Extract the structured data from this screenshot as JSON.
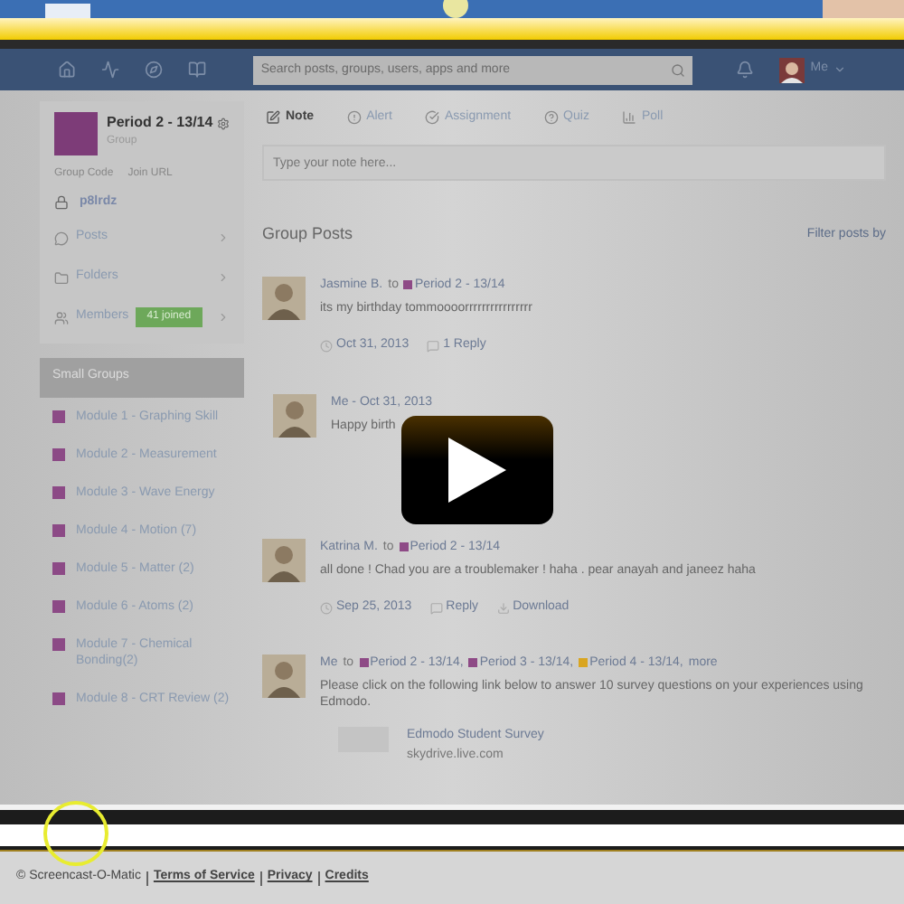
{
  "nav": {
    "search": {
      "placeholder": "Search posts, groups, users, apps and more"
    },
    "user": "Me"
  },
  "group": {
    "title": "Period 2 - 13/14",
    "subtitle": "Group",
    "links": [
      "Group Code",
      "Join URL"
    ],
    "code": "p8lrdz"
  },
  "sidebar": {
    "items": [
      {
        "kind": "posts",
        "label": "Posts"
      },
      {
        "kind": "folders",
        "label": "Folders"
      },
      {
        "kind": "members",
        "label": "Members",
        "badge": "41 joined"
      }
    ]
  },
  "small_groups": {
    "title": "Small Groups",
    "items": [
      "Module 1 - Graphing Skill",
      "Module 2 - Measurement",
      "Module 3 - Wave Energy",
      "Module 4 - Motion (7)",
      "Module 5 - Matter (2)",
      "Module 6 - Atoms (2)",
      "Module 7 - Chemical Bonding(2)",
      "Module 8 - CRT Review (2)"
    ]
  },
  "composer": {
    "tabs": [
      {
        "kind": "note",
        "label": "Note",
        "selected": true
      },
      {
        "kind": "alert",
        "label": "Alert",
        "selected": false
      },
      {
        "kind": "assignment",
        "label": "Assignment",
        "selected": false
      },
      {
        "kind": "quiz",
        "label": "Quiz",
        "selected": false
      },
      {
        "kind": "poll",
        "label": "Poll",
        "selected": false
      }
    ],
    "placeholder": "Type your note here..."
  },
  "feed": {
    "title": "Group Posts",
    "filter": "Filter posts by",
    "posts": [
      {
        "author": "Jasmine B.",
        "to": "to",
        "recipients": [
          {
            "label": "Period 2 - 13/14",
            "color": "#8e4a86"
          }
        ],
        "text": "its my birthday tommoooorrrrrrrrrrrrrrrr",
        "date": "Oct 31, 2013",
        "actions": [
          "1 Reply"
        ],
        "replies": [
          {
            "author": "Me - Oct 31, 2013",
            "text": "Happy birth"
          }
        ]
      },
      {
        "author": "Katrina M.",
        "to": "to",
        "recipients": [
          {
            "label": "Period 2 - 13/14",
            "color": "#8e4a86"
          }
        ],
        "text": "all done ! Chad you are a troublemaker ! haha . pear anayah and janeez haha",
        "date": "Sep 25, 2013",
        "actions": [
          "Reply",
          "Download"
        ]
      },
      {
        "author": "Me",
        "to": "to",
        "recipients": [
          {
            "label": "Period 2 - 13/14,",
            "color": "#8e4a86"
          },
          {
            "label": "Period 3 - 13/14,",
            "color": "#8e4a86"
          },
          {
            "label": "Period 4 - 13/14,",
            "color": "#d9a520"
          },
          {
            "label": "more"
          }
        ],
        "text": "Please click on the following link below to answer 10 survey questions on your experiences using Edmodo.",
        "link": {
          "title": "Edmodo Student Survey",
          "url": "skydrive.live.com"
        }
      }
    ]
  },
  "footer": {
    "copyright": "© Screencast-O-Matic",
    "links": [
      "Terms of Service",
      "Privacy",
      "Credits"
    ]
  }
}
